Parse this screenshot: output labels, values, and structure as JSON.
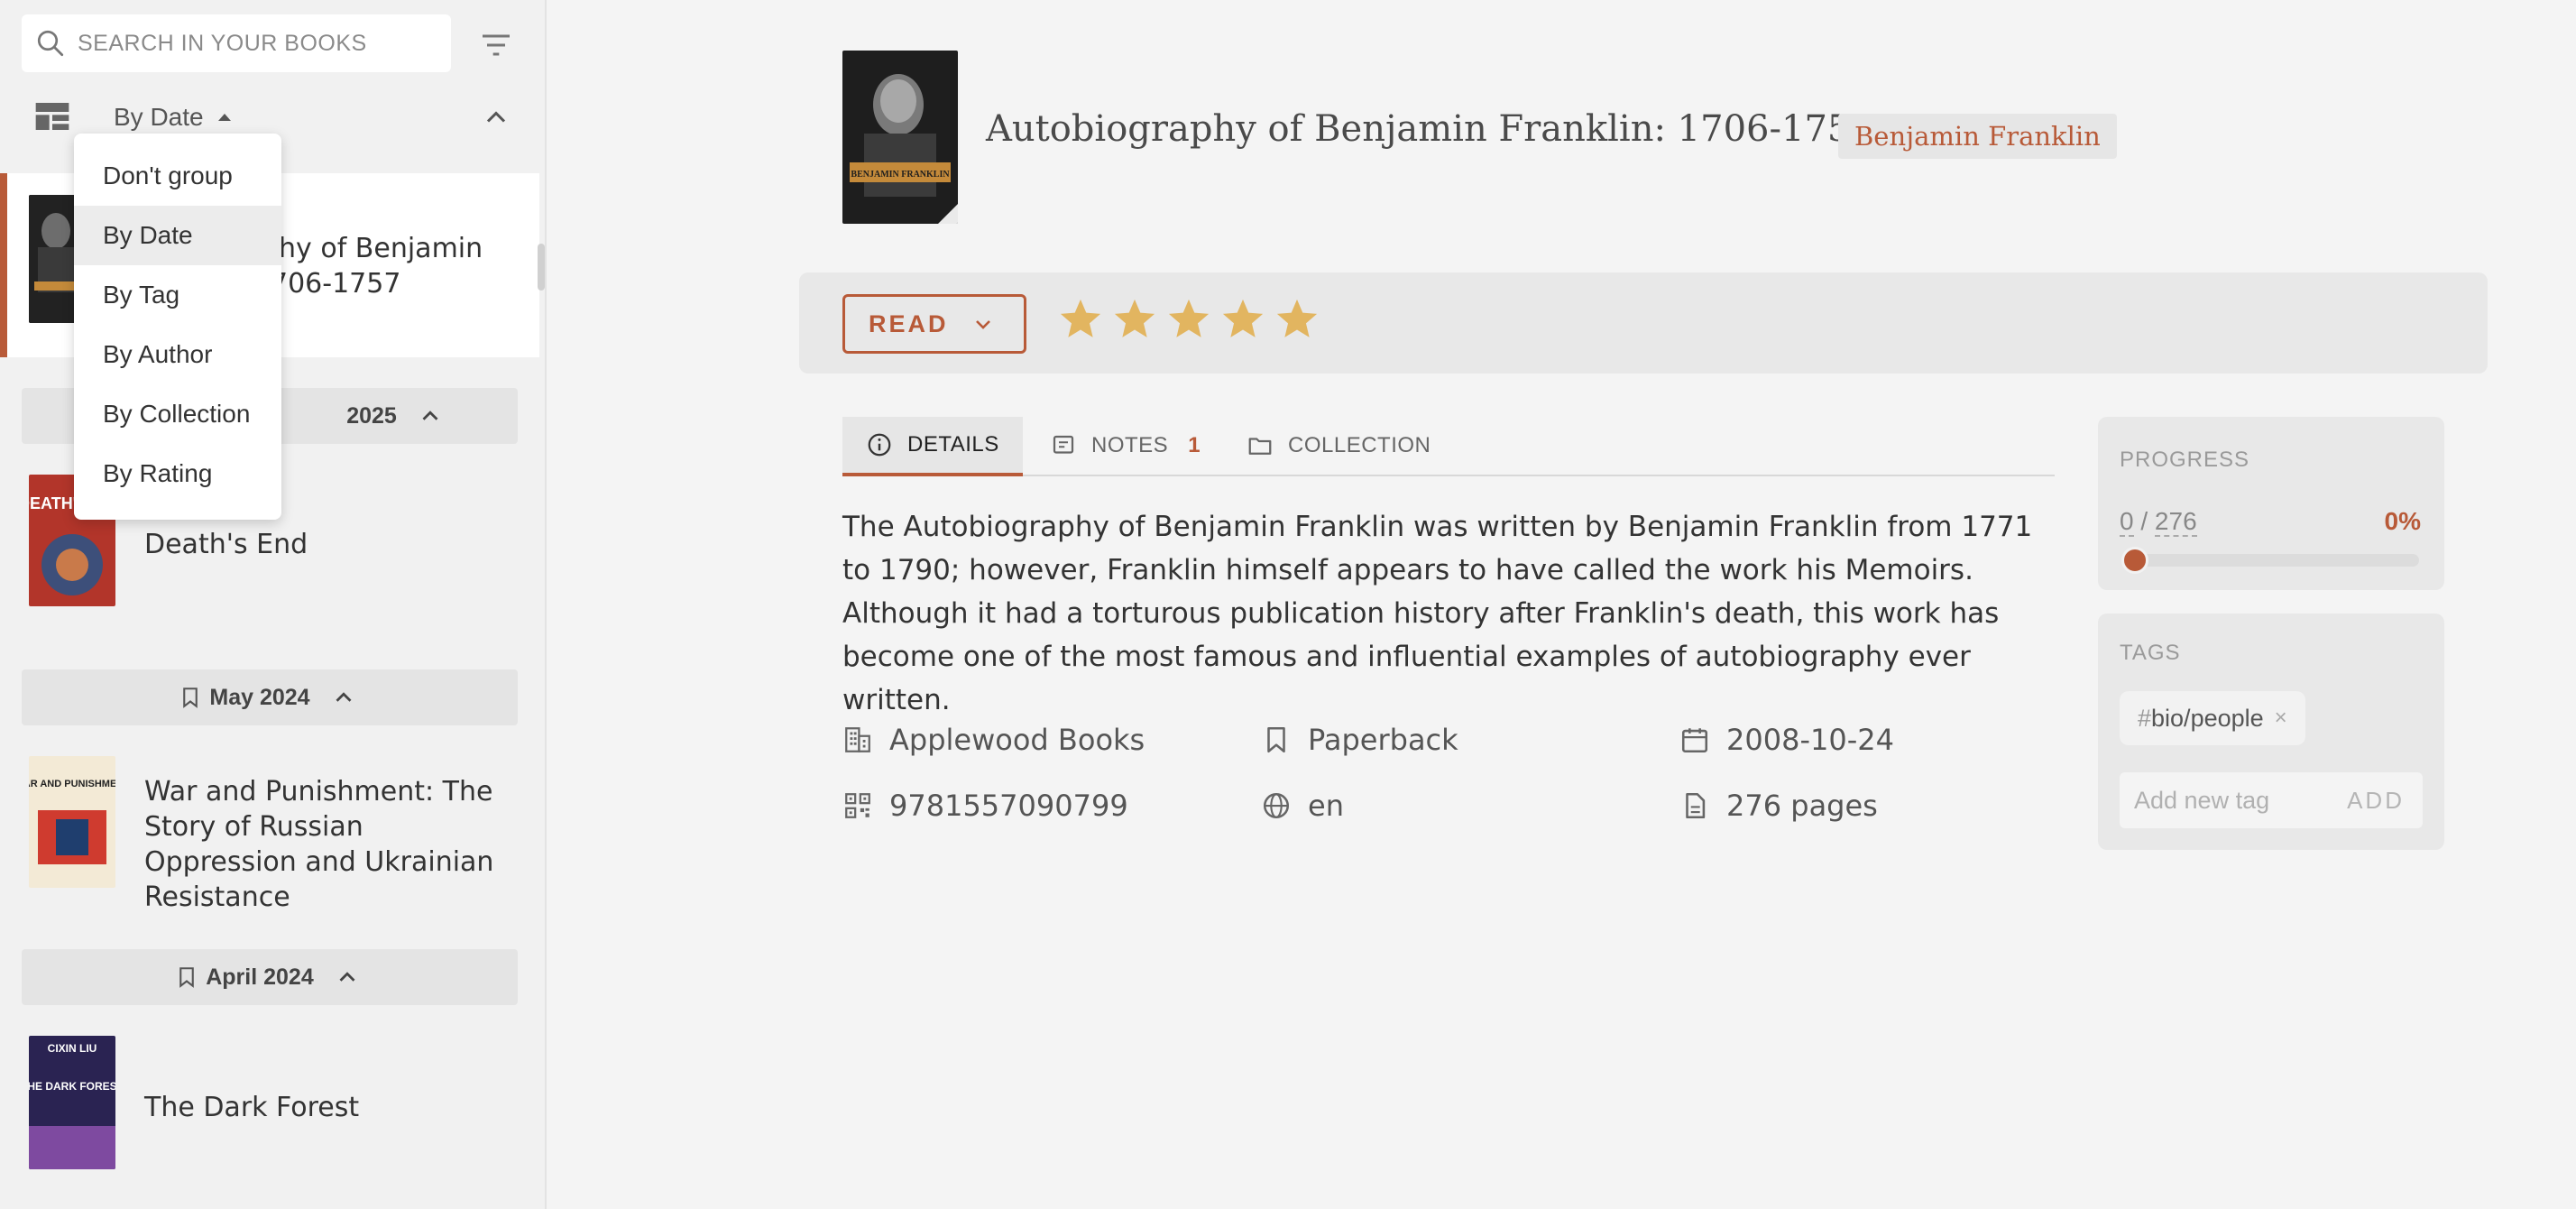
{
  "sidebar": {
    "search": {
      "placeholder": "SEARCH IN YOUR BOOKS"
    },
    "sort": {
      "label": "By Date"
    },
    "dropdown": {
      "items": [
        "Don't group",
        "By Date",
        "By Tag",
        "By Author",
        "By Collection",
        "By Rating"
      ],
      "active": "By Date"
    },
    "selected_book": {
      "title_line1": "Autobiography of Benjamin",
      "title_line2": "Franklin: 1706-1757",
      "visible_line1": "phy of Benjamin",
      "visible_line2": "706-1757"
    },
    "groups": [
      {
        "label": "2025",
        "books": [
          {
            "title": "Death's End",
            "cover_text": "DEATH'S END"
          }
        ]
      },
      {
        "label": "May 2024",
        "books": [
          {
            "title": "War and Punishment: The Story of Russian Oppression and Ukrainian Resistance",
            "cover_text": "WAR AND PUNISHMENT"
          }
        ]
      },
      {
        "label": "April 2024",
        "books": [
          {
            "title": "The Dark Forest",
            "cover_text": "THE DARK FOREST",
            "cover_author": "CIXIN LIU"
          }
        ]
      }
    ]
  },
  "book": {
    "title": "Autobiography of Benjamin Franklin: 1706-1757",
    "author": "Benjamin Franklin",
    "cover_text": "BENJAMIN FRANKLIN",
    "status": "READ",
    "rating": 5,
    "rating_max": 5,
    "tabs": {
      "details": "DETAILS",
      "notes": "NOTES",
      "notes_count": "1",
      "collection": "COLLECTION"
    },
    "description": "The Autobiography of Benjamin Franklin was written by Benjamin Franklin from 1771 to 1790; however, Franklin himself appears to have called the work his Memoirs. Although it had a torturous publication history after Franklin's death, this work has become one of the most famous and influential examples of autobiography ever written.",
    "publisher": "Applewood Books",
    "format": "Paperback",
    "date": "2008-10-24",
    "isbn": "9781557090799",
    "language": "en",
    "pages": "276 pages"
  },
  "progress": {
    "label": "PROGRESS",
    "current": "0",
    "total": "276",
    "percent": "0%",
    "fraction": 0
  },
  "tags": {
    "label": "TAGS",
    "items": [
      "bio/people"
    ],
    "input_placeholder": "Add new tag",
    "add_label": "ADD"
  },
  "colors": {
    "accent": "#b85a38",
    "star": "#e2b560"
  }
}
